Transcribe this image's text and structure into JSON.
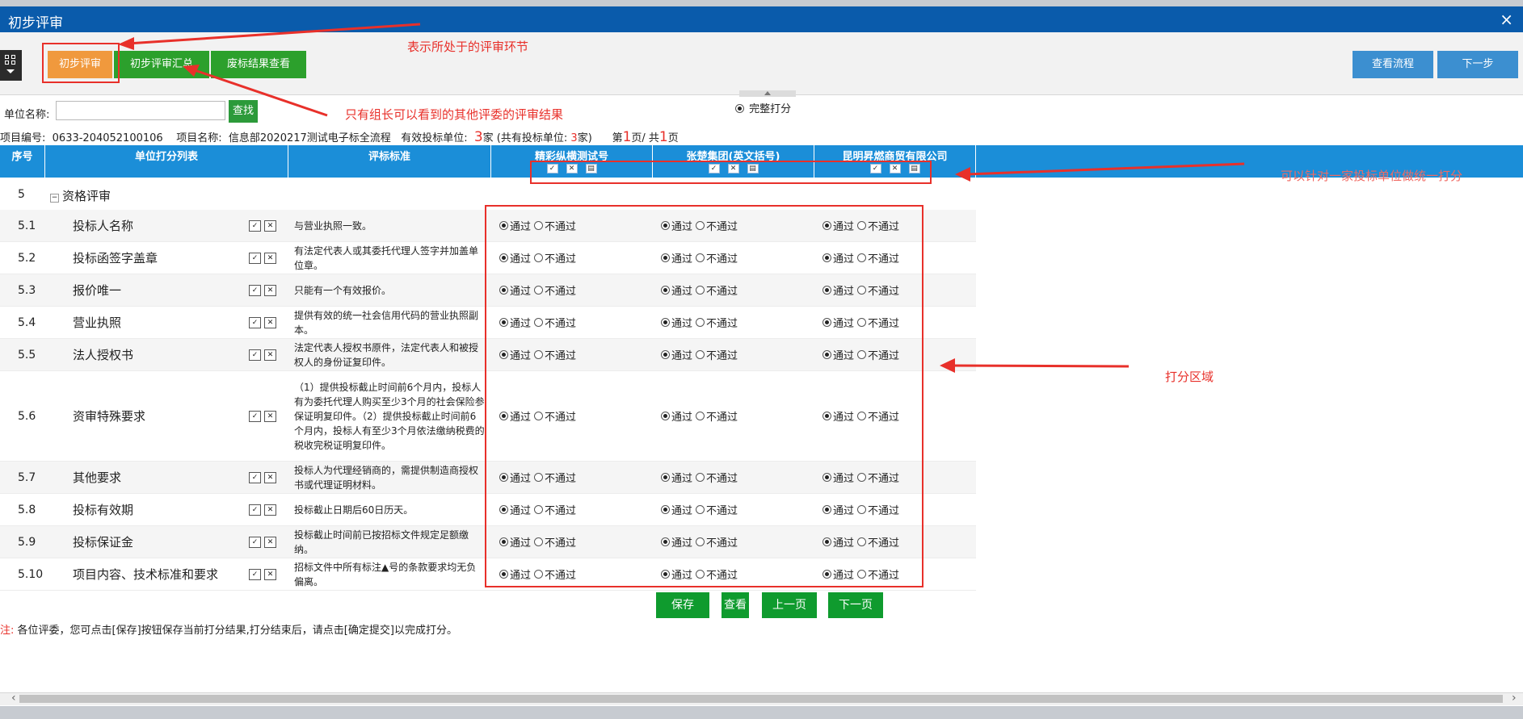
{
  "window": {
    "title": "初步评审",
    "close_icon": "×"
  },
  "tabs": [
    {
      "label": "初步评审"
    },
    {
      "label": "初步评审汇总"
    },
    {
      "label": "废标结果查看"
    }
  ],
  "top_right_buttons": {
    "view_flow": "查看流程",
    "next_step": "下一步"
  },
  "annotations": {
    "stage": "表示所处于的评审环节",
    "leader_only": "只有组长可以看到的其他评委的评审结果",
    "batch": "可以针对一家投标单位做统一打分",
    "score_area": "打分区域"
  },
  "search": {
    "label": "单位名称:",
    "value": "",
    "button": "查找"
  },
  "full_score": "完整打分",
  "project": {
    "no_label": "项目编号:",
    "no": "0633-204052100106",
    "name_label": "项目名称:",
    "name": "信息部2020217测试电子标全流程",
    "valid_label": "有效投标单位:",
    "valid_count": "3",
    "valid_suffix": "家 (共有投标单位:",
    "total_count": "3",
    "total_suffix": "家)",
    "page_prefix": "第",
    "page_current": "1",
    "page_mid": "页/ 共",
    "page_total": "1",
    "page_suffix": "页"
  },
  "columns": {
    "no": "序号",
    "list": "单位打分列表",
    "standard": "评标标准",
    "bidders": [
      "精彩纵横测试号",
      "张楚集团(英文括号)",
      "昆明昇燃商贸有限公司"
    ]
  },
  "section": {
    "no": "5",
    "title": "资格评审"
  },
  "options": {
    "pass": "通过",
    "fail": "不通过"
  },
  "rows": [
    {
      "no": "5.1",
      "name": "投标人名称",
      "std": "与营业执照一致。"
    },
    {
      "no": "5.2",
      "name": "投标函签字盖章",
      "std": "有法定代表人或其委托代理人签字并加盖单位章。"
    },
    {
      "no": "5.3",
      "name": "报价唯一",
      "std": "只能有一个有效报价。"
    },
    {
      "no": "5.4",
      "name": "营业执照",
      "std": "提供有效的统一社会信用代码的营业执照副本。"
    },
    {
      "no": "5.5",
      "name": "法人授权书",
      "std": "法定代表人授权书原件，法定代表人和被授权人的身份证复印件。"
    },
    {
      "no": "5.6",
      "name": "资审特殊要求",
      "std": "（1）提供投标截止时间前6个月内，投标人有为委托代理人购买至少3个月的社会保险参保证明复印件。（2）提供投标截止时间前6个月内，投标人有至少3个月依法缴纳税费的税收完税证明复印件。"
    },
    {
      "no": "5.7",
      "name": "其他要求",
      "std": "投标人为代理经销商的，需提供制造商授权书或代理证明材料。"
    },
    {
      "no": "5.8",
      "name": "投标有效期",
      "std": "投标截止日期后60日历天。"
    },
    {
      "no": "5.9",
      "name": "投标保证金",
      "std": "投标截止时间前已按招标文件规定足额缴纳。"
    },
    {
      "no": "5.10",
      "name": "项目内容、技术标准和要求",
      "std": "招标文件中所有标注▲号的条款要求均无负偏离。"
    }
  ],
  "bottom_buttons": {
    "save": "保存",
    "view": "查看",
    "prev": "上一页",
    "next": "下一页"
  },
  "note": {
    "prefix": "注:",
    "text": "各位评委，您可点击[保存]按钮保存当前打分结果,打分结束后，请点击[确定提交]以完成打分。"
  },
  "colors": {
    "title_bar": "#0a5bab",
    "header": "#1b8ed8",
    "accent_orange": "#f0993d",
    "button_green": "#2ca02c",
    "button_blue": "#3c8fd0",
    "annotation_red": "#e8302a"
  }
}
